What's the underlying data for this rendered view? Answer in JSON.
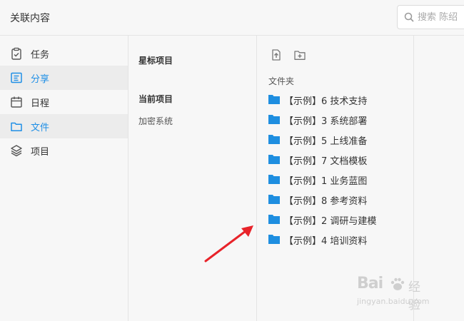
{
  "header": {
    "title": "关联内容",
    "search_placeholder": "搜索 陈绍",
    "search_icon": "search-icon"
  },
  "sidebar": {
    "items": [
      {
        "label": "任务",
        "icon": "clipboard-check-icon",
        "active": false
      },
      {
        "label": "分享",
        "icon": "share-card-icon",
        "active": true
      },
      {
        "label": "日程",
        "icon": "calendar-icon",
        "active": false
      },
      {
        "label": "文件",
        "icon": "folder-outline-icon",
        "active": true
      },
      {
        "label": "项目",
        "icon": "layers-icon",
        "active": false
      }
    ]
  },
  "projects": {
    "starred_heading": "星标项目",
    "current_heading": "当前项目",
    "current_items": [
      "加密系统"
    ]
  },
  "files": {
    "toolbar": [
      "upload-file-icon",
      "new-folder-icon"
    ],
    "section_label": "文件夹",
    "folders": [
      "【示例】6 技术支持",
      "【示例】3 系统部署",
      "【示例】5 上线准备",
      "【示例】7 文档模板",
      "【示例】1 业务蓝图",
      "【示例】8 参考资料",
      "【示例】2 调研与建模",
      "【示例】4 培训资料"
    ]
  },
  "watermark": {
    "brand": "Bai",
    "brand2": "经验",
    "url": "jingyan.baidu.com"
  },
  "colors": {
    "accent": "#1f8fe6",
    "folder": "#1e8ee0",
    "arrow": "#e8232a",
    "border": "#e4e4e4"
  }
}
